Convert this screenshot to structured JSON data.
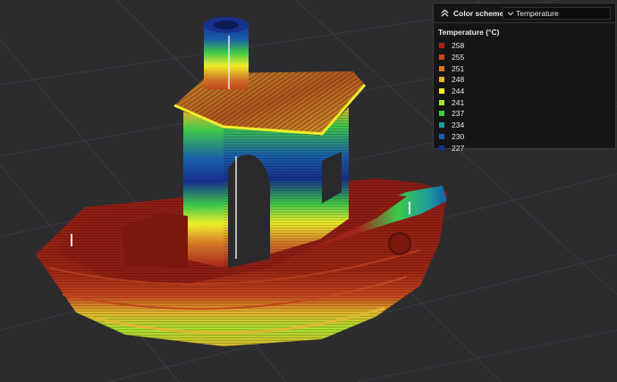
{
  "legend": {
    "scheme_label": "Color scheme",
    "selected_scheme": "Temperature",
    "title": "Temperature (°C)",
    "items": [
      {
        "label": "258",
        "color": "#a8231a"
      },
      {
        "label": "255",
        "color": "#c4451e"
      },
      {
        "label": "251",
        "color": "#d2762a"
      },
      {
        "label": "248",
        "color": "#e0b62c"
      },
      {
        "label": "244",
        "color": "#f0ee2a"
      },
      {
        "label": "241",
        "color": "#a6e02c"
      },
      {
        "label": "237",
        "color": "#3ec84a"
      },
      {
        "label": "234",
        "color": "#1c9e9a"
      },
      {
        "label": "230",
        "color": "#1a5ea8"
      },
      {
        "label": "227",
        "color": "#16308e"
      }
    ]
  },
  "icons": {
    "collapse": "chevron-up-icon",
    "dropdown": "chevron-down-icon"
  }
}
